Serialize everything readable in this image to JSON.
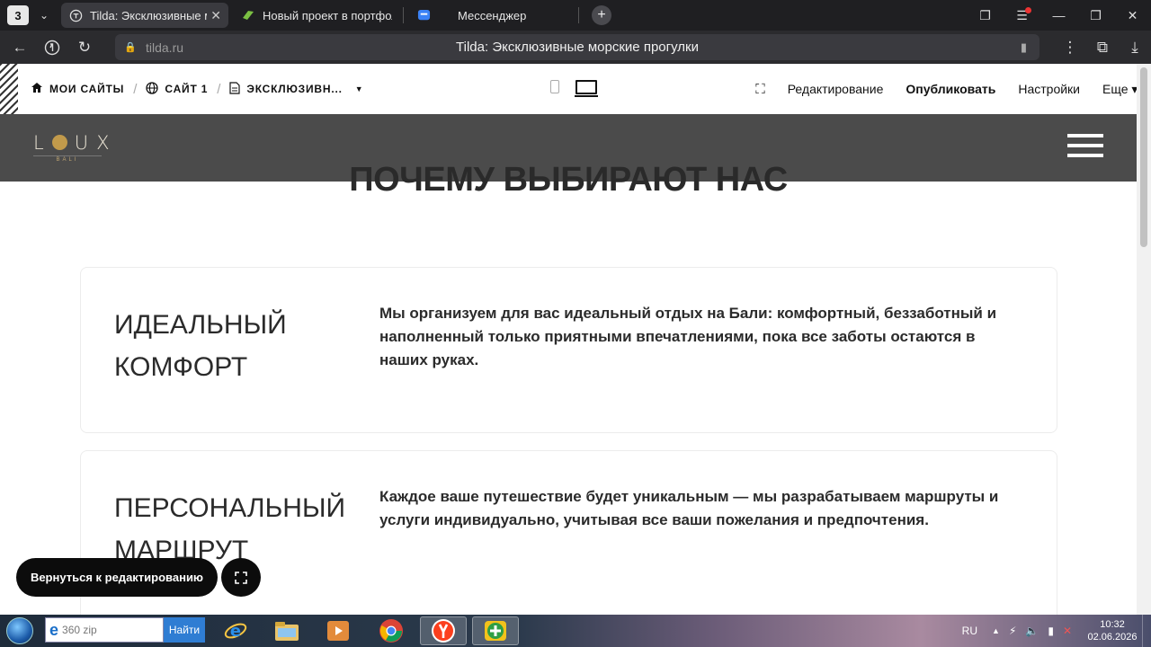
{
  "browser": {
    "tab_count": "3",
    "tabs": [
      {
        "title": "Tilda: Эксклюзивные м",
        "active": true
      },
      {
        "title": "Новый проект в портфол",
        "active": false
      },
      {
        "title": "Мессенджер",
        "active": false
      }
    ],
    "address": {
      "host": "tilda.ru",
      "page_title": "Tilda: Эксклюзивные морские прогулки"
    }
  },
  "tilda_bar": {
    "breadcrumb": [
      {
        "label": "МОИ САЙТЫ",
        "icon": "home-icon"
      },
      {
        "label": "САЙТ 1",
        "icon": "globe-icon"
      },
      {
        "label": "ЭКСКЛЮЗИВН...",
        "icon": "page-icon"
      }
    ],
    "actions": {
      "edit": "Редактирование",
      "publish": "Опубликовать",
      "settings": "Настройки",
      "more": "Еще"
    }
  },
  "site": {
    "logo": "LOUX",
    "logo_sub": "BALI",
    "section_title": "ПОЧЕМУ ВЫБИРАЮТ НАС",
    "cards": [
      {
        "title": "ИДЕАЛЬНЫЙ КОМФОРТ",
        "text": "Мы организуем для вас идеальный отдых на Бали: комфортный, беззаботный и наполненный только приятными впечатлениями, пока все заботы остаются в наших руках."
      },
      {
        "title": "ПЕРСОНАЛЬНЫЙ МАРШРУТ",
        "text": "Каждое ваше путешествие будет уникальным — мы разрабатываем маршруты и услуги индивидуально, учитывая все ваши пожелания и предпочтения."
      }
    ],
    "back_button": "Вернуться к редактированию"
  },
  "taskbar": {
    "search_value": "360 zip",
    "search_button": "Найти",
    "language": "RU",
    "time": "10:32",
    "date": "02.06.2026"
  },
  "colors": {
    "header_bg": "#4b4b4b",
    "logo_gold": "#c19a4b",
    "dark_button": "#0c0c0c"
  }
}
